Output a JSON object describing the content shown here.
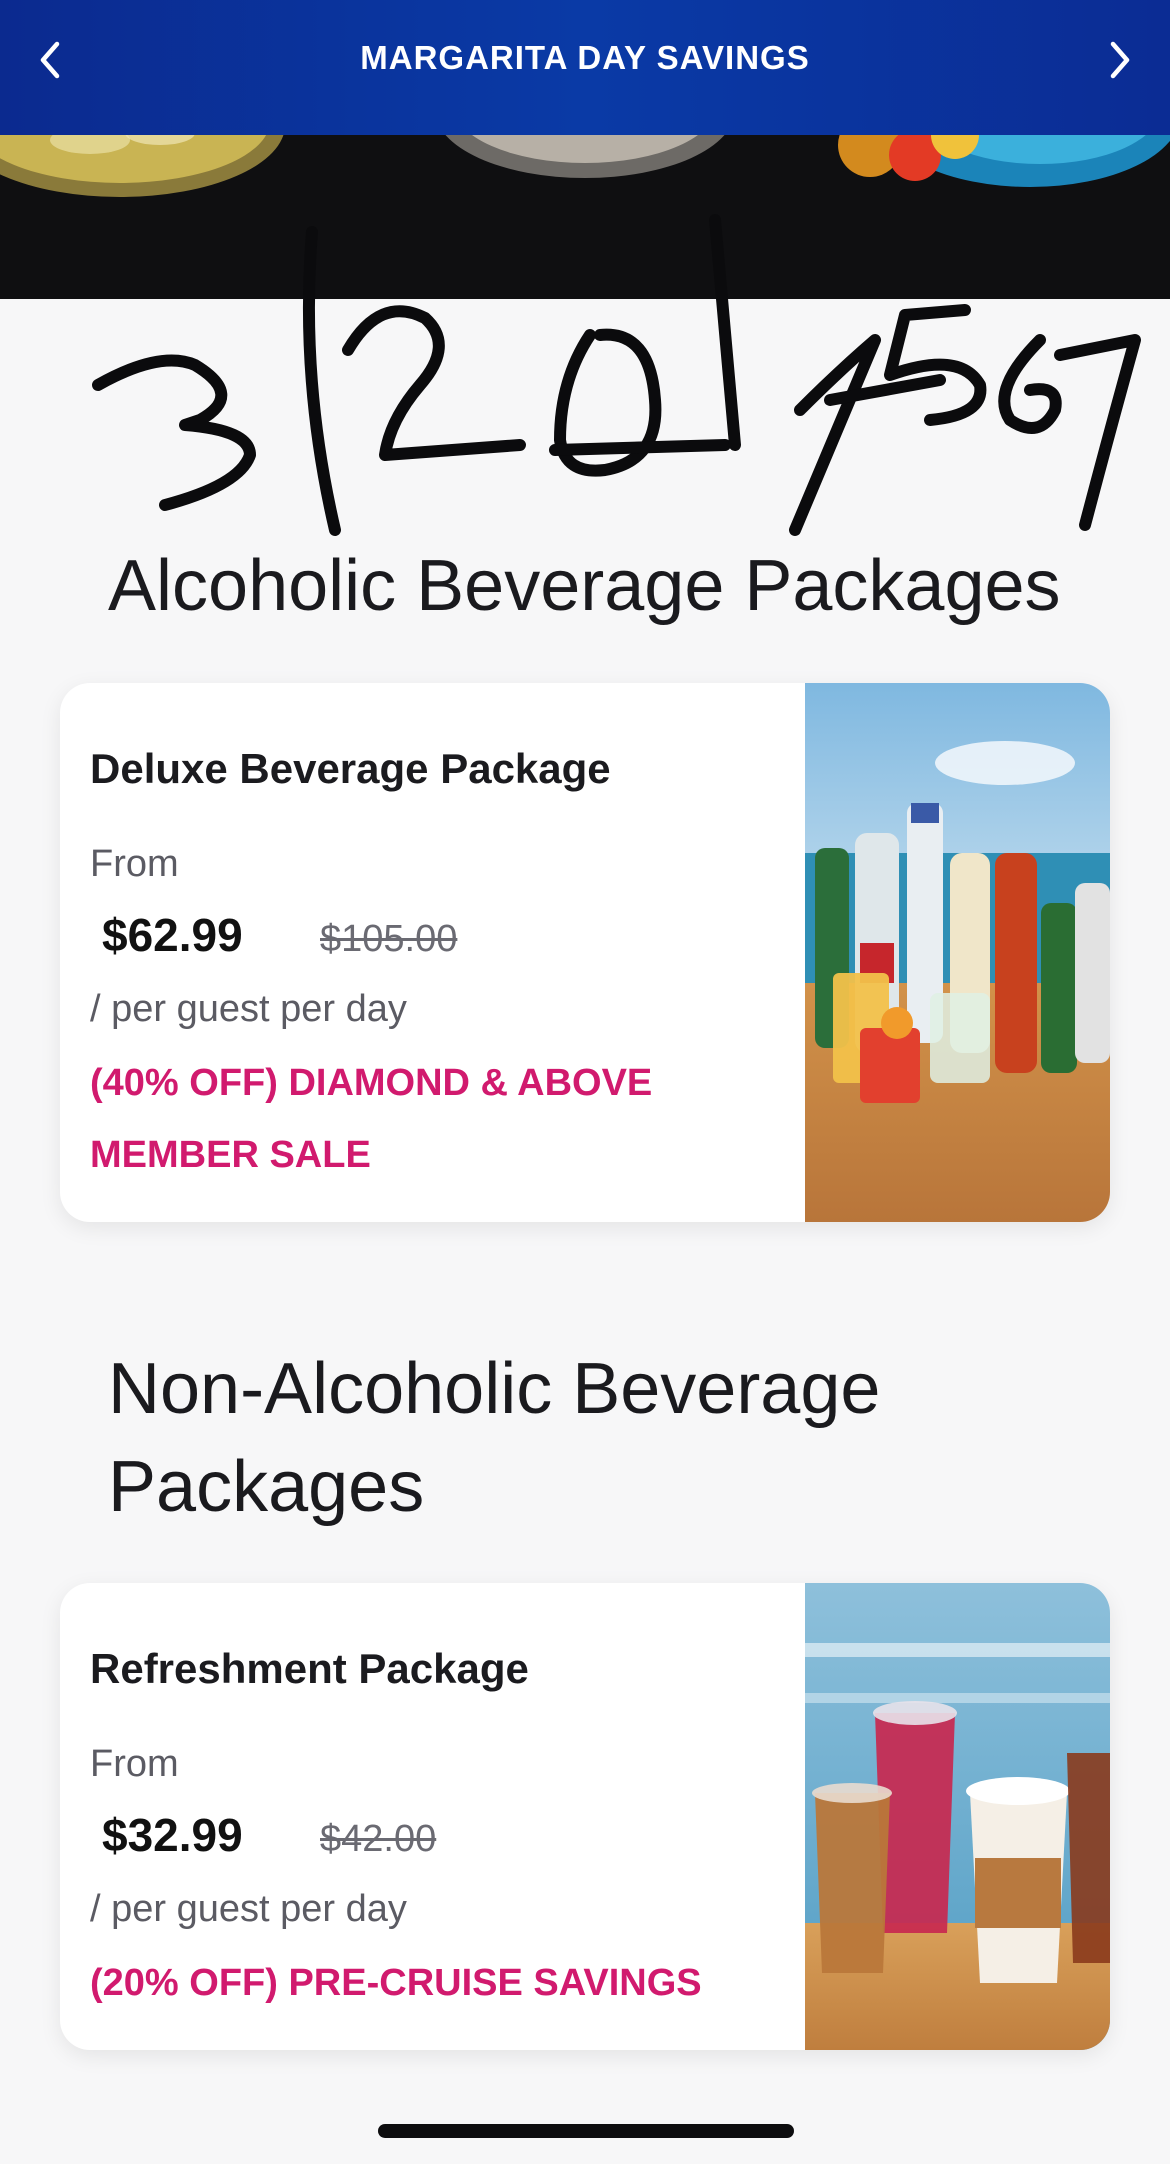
{
  "header": {
    "title": "MARGARITA DAY SAVINGS",
    "back_icon": "chevron-left-icon",
    "forward_icon": "chevron-right-icon"
  },
  "handwritten_annotation": "3/20/4567",
  "sections": [
    {
      "title": "Alcoholic Beverage Packages",
      "card": {
        "name": "Deluxe Beverage Package",
        "from_label": "From",
        "price": "$62.99",
        "original_price": "$105.00",
        "per_label": "/ per guest per day",
        "promo": "(40% OFF) DIAMOND & ABOVE MEMBER SALE"
      }
    },
    {
      "title": "Non-Alcoholic Beverage Packages",
      "card": {
        "name": "Refreshment Package",
        "from_label": "From",
        "price": "$32.99",
        "original_price": "$42.00",
        "per_label": "/ per guest per day",
        "promo": "(20% OFF) PRE-CRUISE SAVINGS"
      }
    }
  ],
  "colors": {
    "header_blue": "#0a3aa6",
    "promo_pink": "#d11a6e",
    "card_bg": "#ffffff"
  }
}
